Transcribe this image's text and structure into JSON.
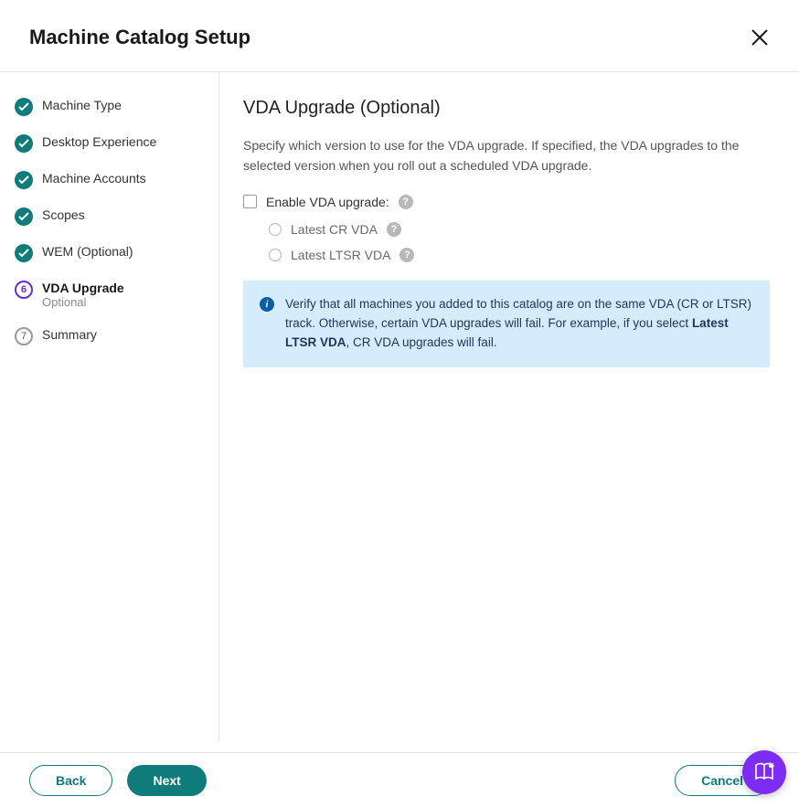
{
  "header": {
    "title": "Machine Catalog Setup"
  },
  "steps": [
    {
      "label": "Machine Type"
    },
    {
      "label": "Desktop Experience"
    },
    {
      "label": "Machine Accounts"
    },
    {
      "label": "Scopes"
    },
    {
      "label": "WEM (Optional)"
    },
    {
      "label": "VDA Upgrade",
      "sub": "Optional",
      "num": "6"
    },
    {
      "label": "Summary",
      "num": "7"
    }
  ],
  "main": {
    "heading": "VDA Upgrade (Optional)",
    "description": "Specify which version to use for the VDA upgrade. If specified, the VDA upgrades to the selected version when you roll out a scheduled VDA upgrade.",
    "enable_label": "Enable VDA upgrade:",
    "options": {
      "cr": "Latest CR VDA",
      "ltsr": "Latest LTSR VDA"
    },
    "info": {
      "pre": "Verify that all machines you added to this catalog are on the same VDA (CR or LTSR) track. Otherwise, certain VDA upgrades will fail. For example, if you select ",
      "bold": "Latest LTSR VDA",
      "post": ", CR VDA upgrades will fail."
    }
  },
  "buttons": {
    "back": "Back",
    "next": "Next",
    "cancel": "Cancel"
  }
}
